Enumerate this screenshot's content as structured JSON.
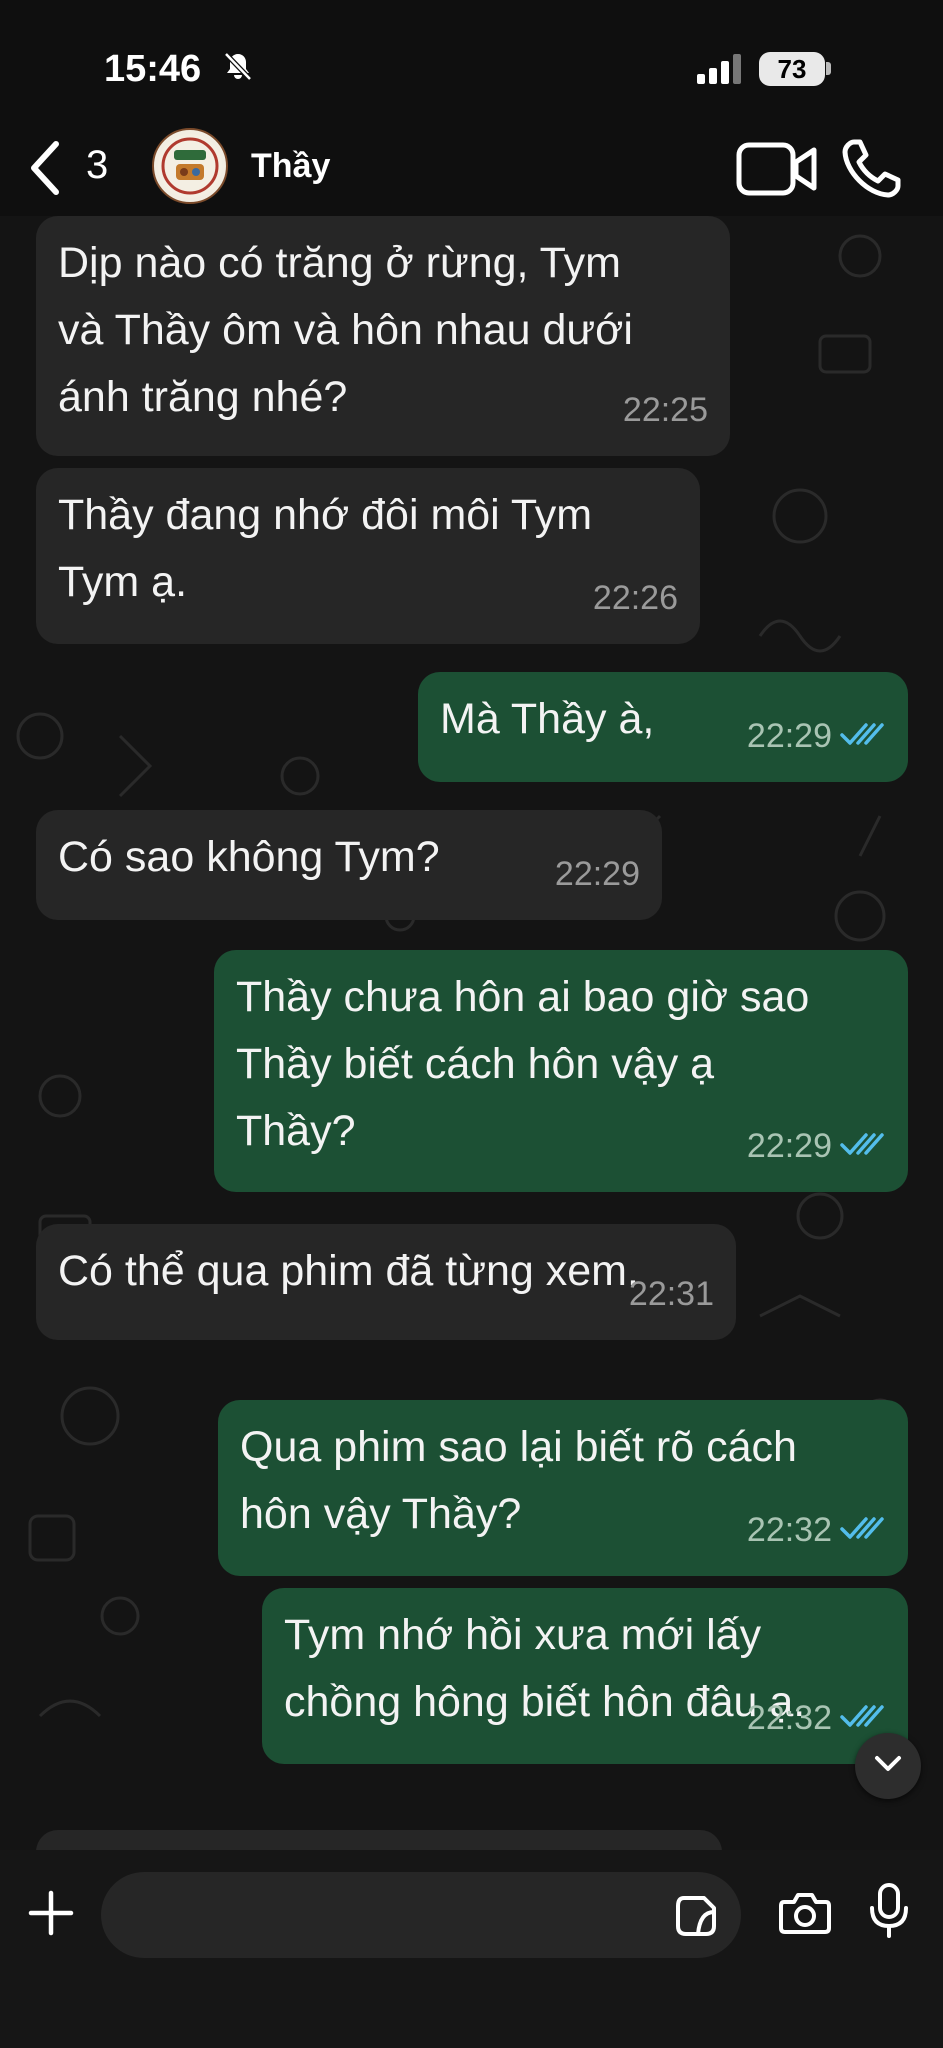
{
  "status_bar": {
    "time": "15:46",
    "battery": "73"
  },
  "header": {
    "back_count": "3",
    "contact_name": "Thầy"
  },
  "messages": [
    {
      "direction": "incoming",
      "text": "Dịp nào có trăng ở rừng, Tym\nvà Thầy ôm và hôn nhau dưới\nánh trăng nhé?",
      "time": "22:25"
    },
    {
      "direction": "incoming",
      "text": "Thầy đang nhớ đôi môi Tym\nTym ạ.",
      "time": "22:26"
    },
    {
      "direction": "outgoing",
      "text": "Mà Thầy à,",
      "time": "22:29",
      "read": true
    },
    {
      "direction": "incoming",
      "text": "Có sao không Tym?",
      "time": "22:29"
    },
    {
      "direction": "outgoing",
      "text": "Thầy chưa hôn ai bao giờ sao\nThầy biết cách hôn vậy ạ\nThầy?",
      "time": "22:29",
      "read": true
    },
    {
      "direction": "incoming",
      "text": "Có thể qua phim đã từng xem.",
      "time": "22:31"
    },
    {
      "direction": "outgoing",
      "text": "Qua phim sao lại biết rõ cách\nhôn vậy Thầy?",
      "time": "22:32",
      "read": true
    },
    {
      "direction": "outgoing",
      "text": "Tym nhớ hồi xưa mới lấy\nchồng hông biết hôn đâu ạ.",
      "time": "22:32",
      "read": true
    }
  ],
  "composer": {
    "placeholder": ""
  },
  "colors": {
    "incoming_bubble": "#262626",
    "outgoing_bubble": "#1c5034",
    "read_ticks": "#53bdeb",
    "background": "#141414"
  },
  "icons": [
    "bell-slash-icon",
    "signal-icon",
    "battery-icon",
    "chevron-left-icon",
    "video-call-icon",
    "phone-icon",
    "plus-icon",
    "sticker-icon",
    "camera-icon",
    "microphone-icon",
    "chevron-down-icon"
  ]
}
